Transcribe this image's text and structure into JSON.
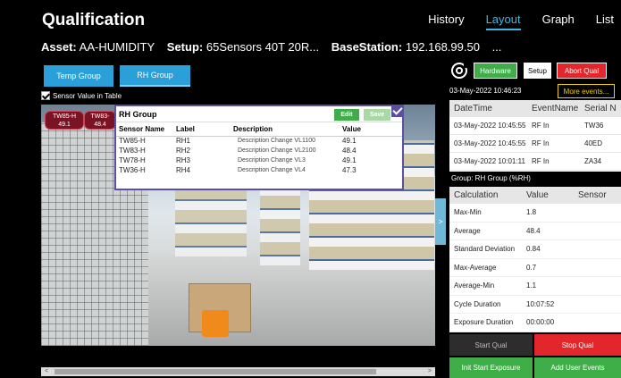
{
  "app": {
    "title": "Qualification"
  },
  "nav": {
    "items": [
      {
        "label": "History"
      },
      {
        "label": "Layout"
      },
      {
        "label": "Graph"
      },
      {
        "label": "List"
      }
    ],
    "active": "Layout"
  },
  "assetline": {
    "asset_label": "Asset:",
    "asset_value": "AA-HUMIDITY",
    "setup_label": "Setup:",
    "setup_value": "65Sensors 40T 20R...",
    "base_label": "BaseStation:",
    "base_value": "192.168.99.50",
    "trail": "..."
  },
  "groups": {
    "temp_label": "Temp Group",
    "rh_label": "RH Group",
    "active": "RH Group"
  },
  "checkbox": {
    "label": "Sensor Value in Table",
    "checked": true
  },
  "tags": [
    {
      "name": "TW85-H",
      "value": "49.1"
    },
    {
      "name": "TW83-",
      "value": "48.4"
    }
  ],
  "rh_panel": {
    "title": "RH Group",
    "edit_label": "Edit",
    "save_label": "Save",
    "headers": [
      "Sensor Name",
      "Label",
      "Description",
      "Value"
    ],
    "rows": [
      [
        "TW85-H",
        "RH1",
        "Description Change VL1100",
        "49.1"
      ],
      [
        "TW83-H",
        "RH2",
        "Description Change VL2100",
        "48.4"
      ],
      [
        "TW78-H",
        "RH3",
        "Description Change VL3",
        "49.1"
      ],
      [
        "TW36-H",
        "RH4",
        "Description Change VL4",
        "47.3"
      ]
    ]
  },
  "side_handle": {
    "glyph": ">"
  },
  "scrollbar": {
    "left_glyph": "<",
    "right_glyph": ">"
  },
  "toolbar": {
    "hardware": "Hardware",
    "setup": "Setup",
    "abort": "Abort Qual",
    "more": "More events..."
  },
  "datetime": "03-May-2022 10:46:23",
  "events": {
    "headers": [
      "DateTime",
      "EventName",
      "Serial N"
    ],
    "rows": [
      [
        "03-May-2022 10:45:55",
        "RF In",
        "TW36"
      ],
      [
        "03-May-2022 10:45:55",
        "RF In",
        "40ED"
      ],
      [
        "03-May-2022 10:01:11",
        "RF In",
        "ZA34"
      ]
    ]
  },
  "group_label": "Group: RH Group (%RH)",
  "stats": {
    "headers": [
      "Calculation",
      "Value",
      "Sensor"
    ],
    "rows": [
      [
        "Max-Min",
        "1.8",
        ""
      ],
      [
        "Average",
        "48.4",
        ""
      ],
      [
        "Standard Deviation",
        "0.84",
        ""
      ],
      [
        "Max-Average",
        "0.7",
        ""
      ],
      [
        "Average-Min",
        "1.1",
        ""
      ],
      [
        "Cycle Duration",
        "10:07:52",
        ""
      ],
      [
        "Exposure Duration",
        "00:00:00",
        ""
      ]
    ]
  },
  "actions": {
    "start": "Start Qual",
    "stop": "Stop Qual",
    "init": "Init Start Exposure",
    "user_events": "Add User Events"
  },
  "colors": {
    "accent": "#3fb6e8",
    "green": "#3fae49",
    "red": "#e3262b",
    "group_blue": "#2a9fd8",
    "panel_border": "#5a4fa3",
    "more_yellow": "#f0d000"
  }
}
